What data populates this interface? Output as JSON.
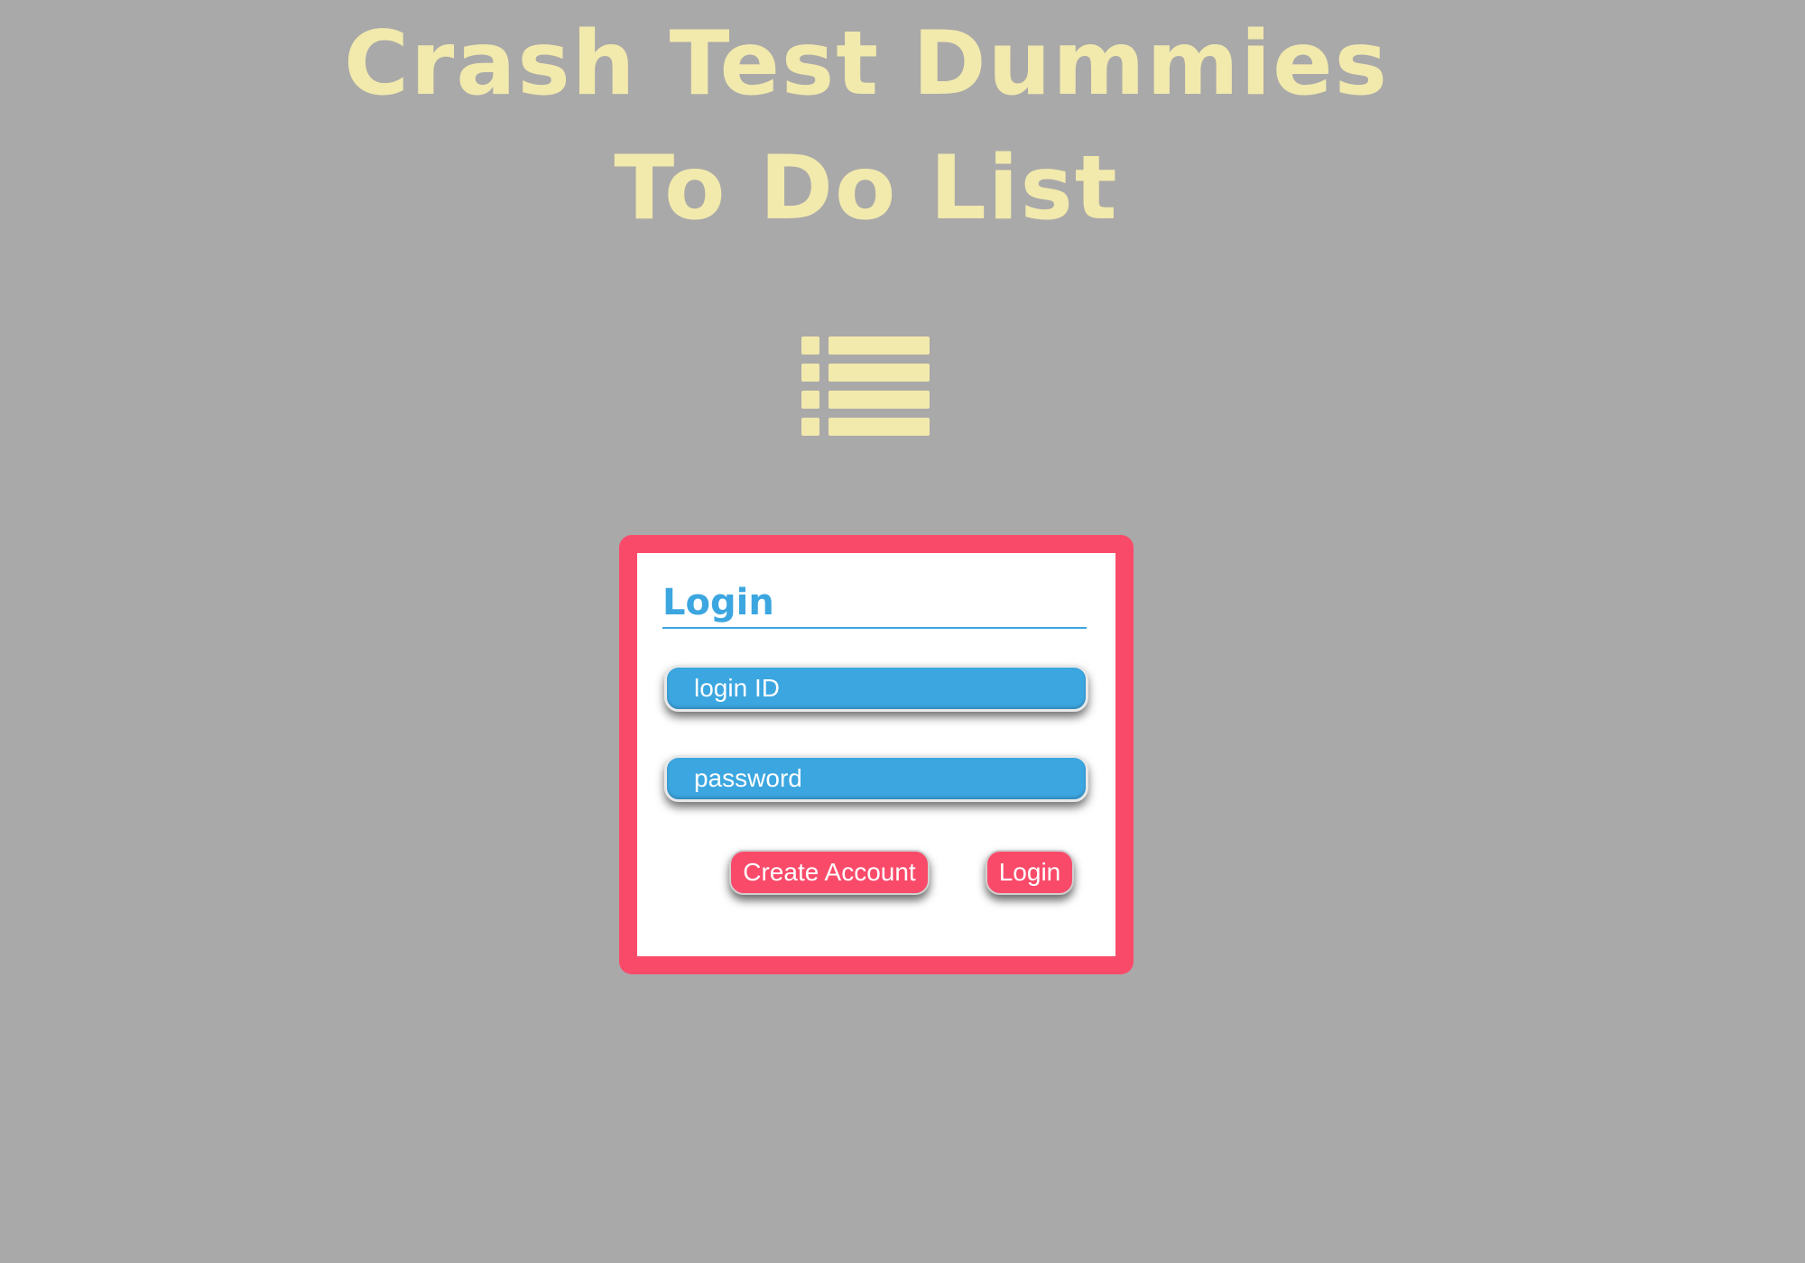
{
  "header": {
    "title_line1": "Crash Test Dummies",
    "title_line2": "To Do List"
  },
  "icon": {
    "name": "list-icon",
    "color": "#f2e9ad"
  },
  "login_card": {
    "heading": "Login",
    "login_id_placeholder": "login ID",
    "password_placeholder": "password",
    "create_account_label": "Create Account",
    "login_button_label": "Login"
  },
  "colors": {
    "background": "#a9a9a9",
    "title": "#f2e9ad",
    "card_border": "#fa4a6a",
    "accent_blue": "#3ca6e0",
    "button": "#fa4a6a"
  }
}
